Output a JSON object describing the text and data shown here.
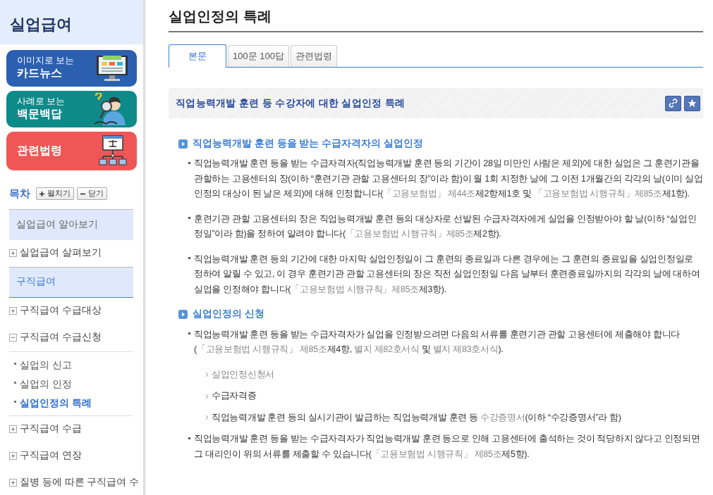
{
  "sidebar": {
    "title": "실업급여",
    "banners": [
      {
        "kind": "news",
        "small": "이미지로 보는",
        "big": "카드뉴스",
        "color": "#2b5fb0"
      },
      {
        "kind": "qa",
        "small": "사례로 보는",
        "big": "백문백답",
        "color": "#0e8a89"
      },
      {
        "kind": "law",
        "big": "관련법령",
        "color": "#f15656"
      }
    ],
    "toc_label": "목차",
    "expand_button": "펼치기",
    "collapse_button": "닫기",
    "toc": [
      {
        "label": "실업급여 알아보기",
        "selected": false,
        "children": [
          {
            "label": "실업급여 살펴보기",
            "expanded": false
          }
        ]
      },
      {
        "label": "구직급여",
        "selected": true,
        "children": [
          {
            "label": "구직급여 수급대상",
            "expanded": false
          },
          {
            "label": "구직급여 수급신청",
            "expanded": true,
            "children": [
              {
                "label": "실업의 신고",
                "selected": false
              },
              {
                "label": "실업의 인정",
                "selected": false
              },
              {
                "label": "실업인정의 특례",
                "selected": true
              }
            ]
          },
          {
            "label": "구직급여 수급",
            "expanded": false
          },
          {
            "label": "구직급여 연장",
            "expanded": false
          },
          {
            "label": "질병 등에 따른 구직급여 수",
            "expanded": false
          }
        ]
      }
    ]
  },
  "page_title": "실업인정의 특례",
  "tabs": [
    {
      "label": "본문",
      "selected": true
    },
    {
      "label": "100문 100답",
      "selected": false
    },
    {
      "label": "관련법령",
      "selected": false
    }
  ],
  "section_title": "직업능력개발 훈련 등 수강자에 대한 실업인정 특례",
  "sections": [
    {
      "heading": "직업능력개발 훈련 등을 받는 수급자격자의 실업인정",
      "items": [
        {
          "kind": "bullet",
          "segments": [
            {
              "kind": "plain",
              "text": "직업능력개발 훈련 등을 받는 수급자격자(직업능력개발 훈련 등의 기간이 28일 미만인 사람은 제외)에 대한 실업은 그 훈련기관을 관할하는 고용센터의 장(이하 “훈련기관 관할 고용센터의 장”이라 함)이 월 1회 지정한 날에 그 이전 1개월간의 각각의 날(이미 실업인정의 대상이 된 날은 제외)에 대해 인정합니다("
            },
            {
              "kind": "link",
              "text": "「고용보험법」 제44조"
            },
            {
              "kind": "plain",
              "text": "제2항제1호 및 "
            },
            {
              "kind": "link",
              "text": "「고용보험법 시행규칙」제85조"
            },
            {
              "kind": "plain",
              "text": "제1항)."
            }
          ]
        },
        {
          "kind": "bullet",
          "segments": [
            {
              "kind": "plain",
              "text": "훈련기관 관할 고용센터의 장은 직업능력개발 훈련 등의 대상자로 선발된 수급자격자에게 실업을 인정받아야 할 날(이하 “실업인정일”이라 함)을 정하여 알려야 합니다("
            },
            {
              "kind": "link",
              "text": "「고용보험법 시행규칙」제85조"
            },
            {
              "kind": "plain",
              "text": "제2항)."
            }
          ]
        },
        {
          "kind": "bullet",
          "segments": [
            {
              "kind": "plain",
              "text": "직업능력개발 훈련 등의 기간에 대한 마지막 실업인정일이 그 훈련의 종료일과 다른 경우에는 그 훈련의 종료일을 실업인정일로 정하여 알릴 수 있고, 이 경우 훈련기관 관할 고용센터의 장은 직전 실업인정일 다음 날부터 훈련종료일까지의 각각의 날에 대하여 실업을 인정해야 합니다("
            },
            {
              "kind": "link",
              "text": "「고용보험법 시행규칙」제85조"
            },
            {
              "kind": "plain",
              "text": "제3항)."
            }
          ]
        }
      ]
    },
    {
      "heading": "실업인정의 신청",
      "items": [
        {
          "kind": "bullet",
          "segments": [
            {
              "kind": "plain",
              "text": "직업능력개발 훈련 등을 받는 수급자격자가 실업을 인정받으려면 다음의 서류를 훈련기관 관할 고용센터에 제출해야 합니다("
            },
            {
              "kind": "link",
              "text": "「고용보험법 시행규칙」 제85조"
            },
            {
              "kind": "plain",
              "text": "제4항, "
            },
            {
              "kind": "link",
              "text": "별지 제82호서식"
            },
            {
              "kind": "plain",
              "text": " 및 "
            },
            {
              "kind": "link",
              "text": "별지 제83호서식"
            },
            {
              "kind": "plain",
              "text": ")."
            }
          ]
        },
        {
          "kind": "doc",
          "segments": [
            {
              "kind": "link",
              "text": "실업인정신청서"
            }
          ]
        },
        {
          "kind": "doc",
          "segments": [
            {
              "kind": "plain",
              "text": "수급자격증"
            }
          ]
        },
        {
          "kind": "doc",
          "segments": [
            {
              "kind": "plain",
              "text": "직업능력개발 훈련 등의 실시기관이 발급하는 직업능력개발 훈련 등 "
            },
            {
              "kind": "link",
              "text": "수강증명서"
            },
            {
              "kind": "plain",
              "text": "(이하 “수강증명서”라 함)"
            }
          ]
        },
        {
          "kind": "bullet",
          "segments": [
            {
              "kind": "plain",
              "text": "직업능력개발 훈련 등을 받는 수급자격자가 직업능력개발 훈련 등으로 인해 고용센터에 출석하는 것이 적당하지 않다고 인정되면 그 대리인이 위의 서류를 제출할 수 있습니다("
            },
            {
              "kind": "link",
              "text": "「고용보험법 시행규칙」 제85조"
            },
            {
              "kind": "plain",
              "text": "제5항)."
            }
          ]
        }
      ]
    }
  ]
}
